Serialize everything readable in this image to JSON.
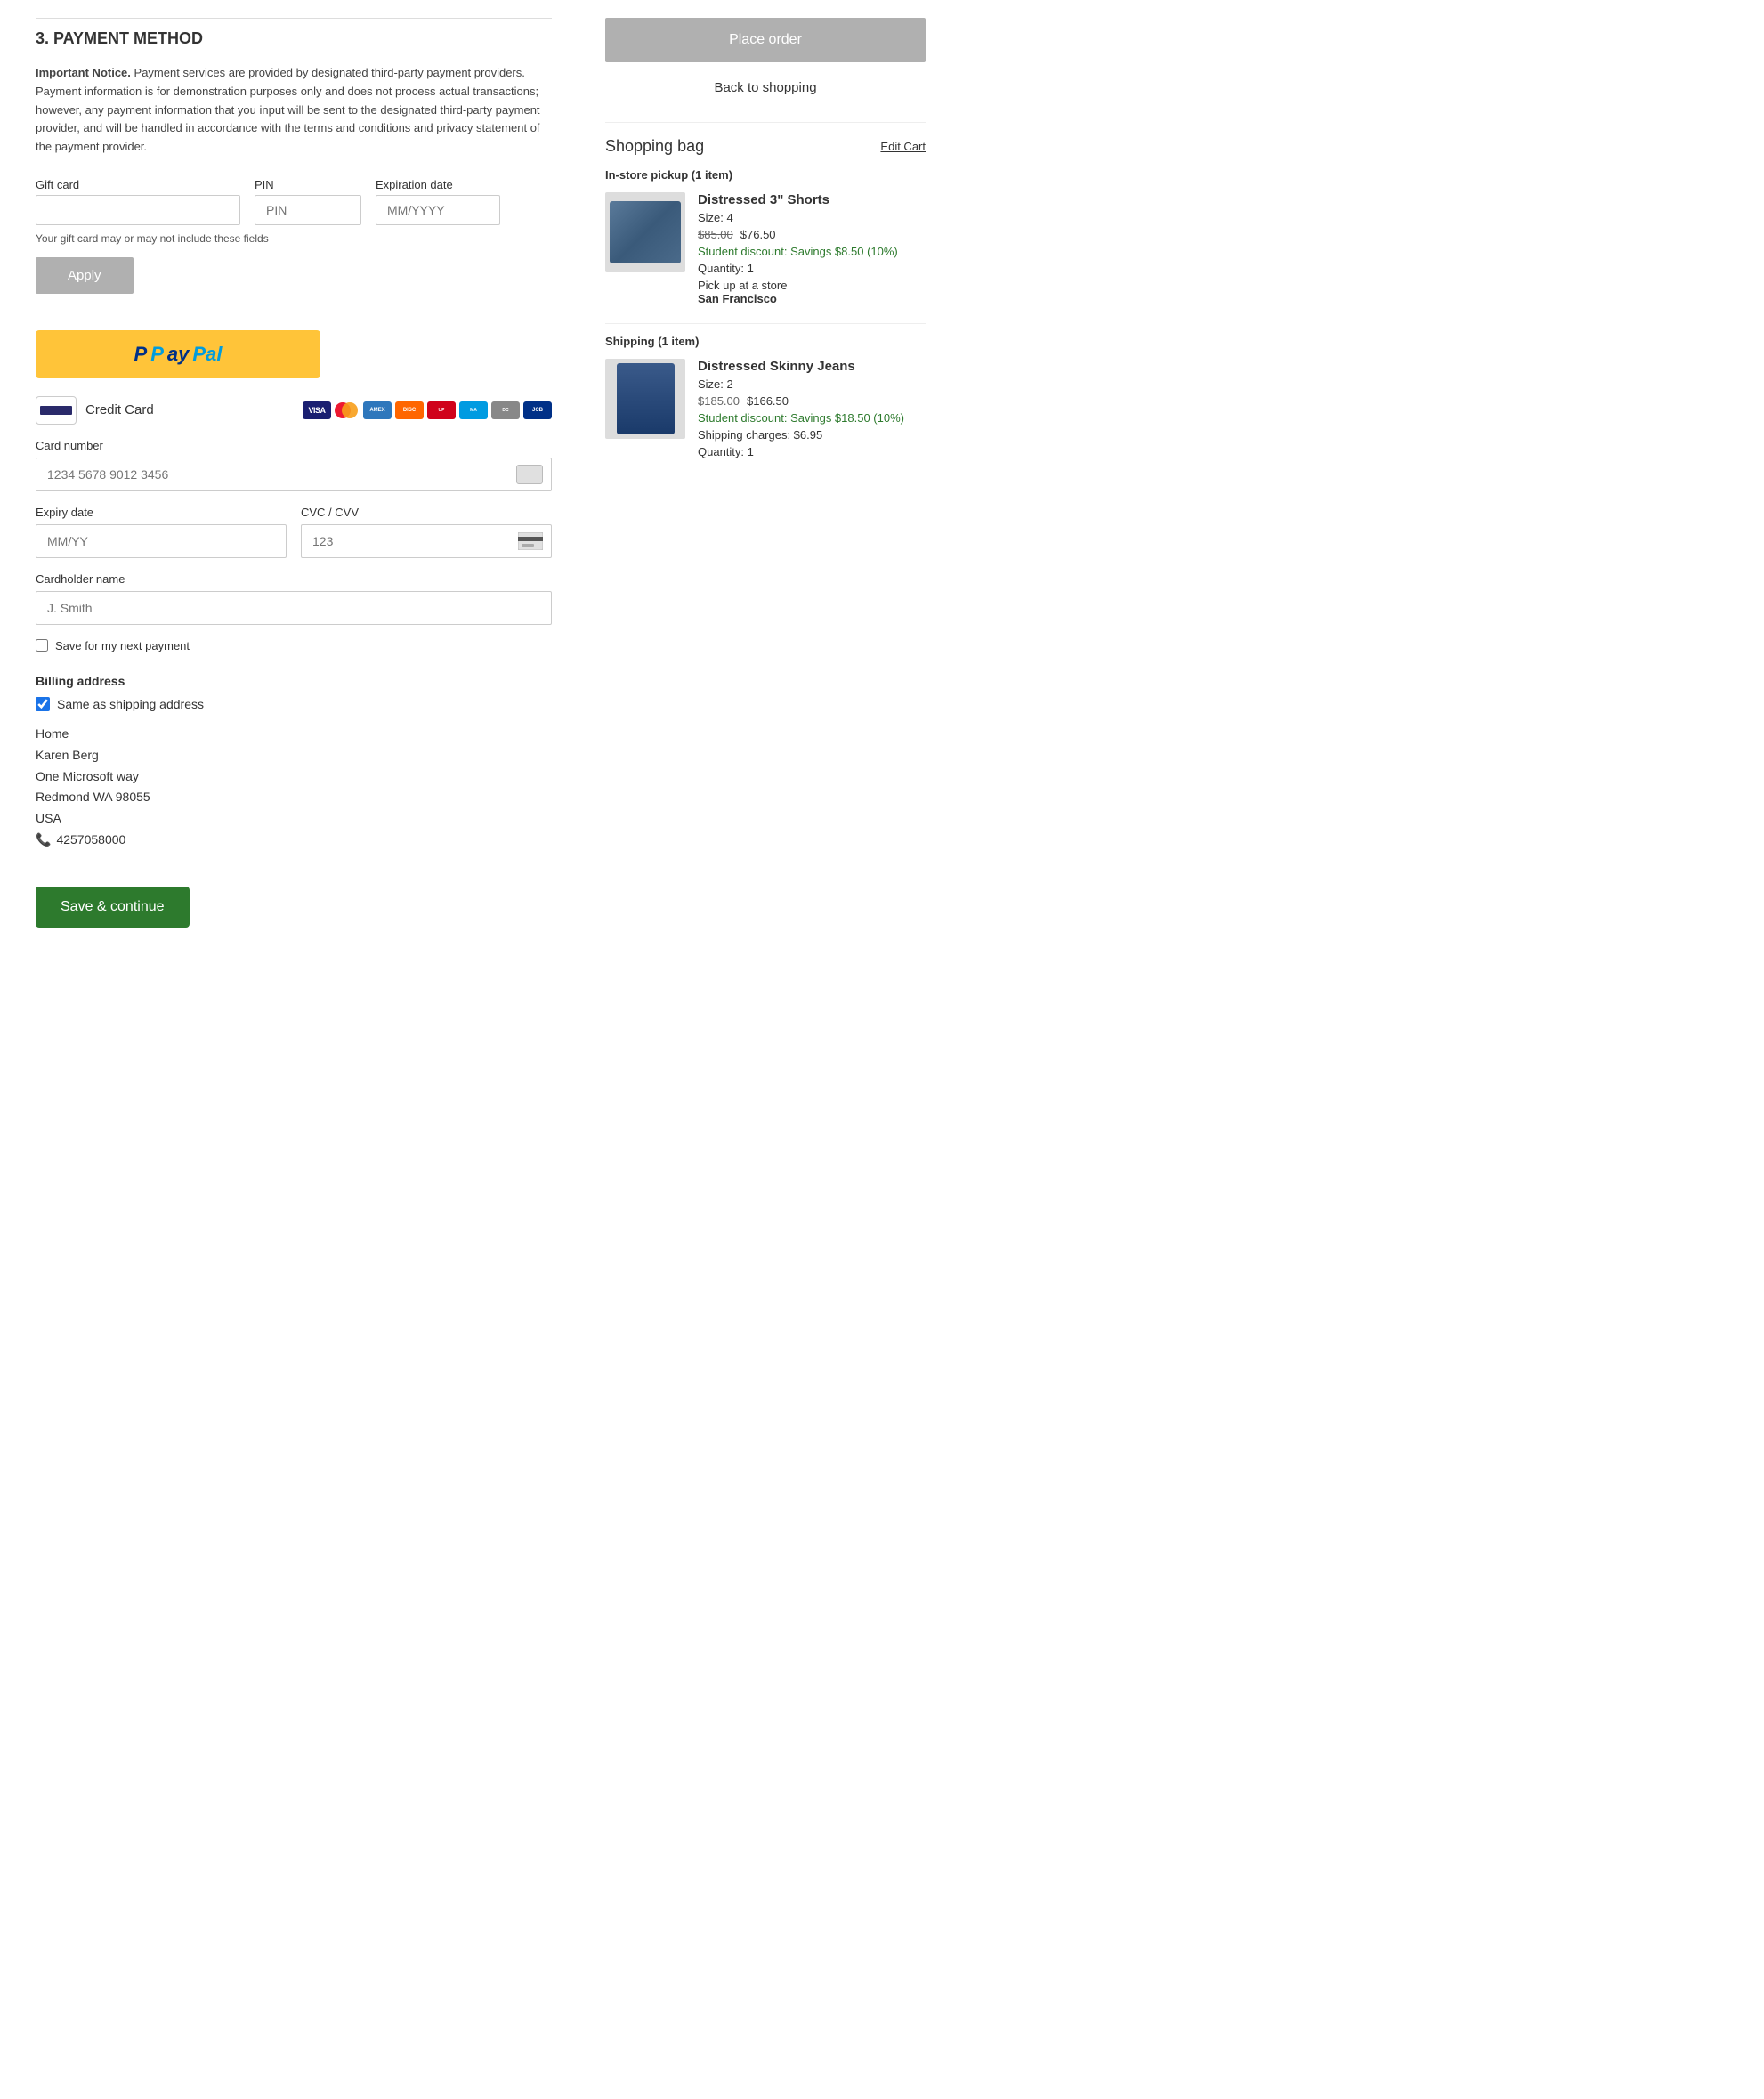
{
  "page": {
    "section_heading": "3. PAYMENT METHOD",
    "notice": {
      "label": "Important Notice.",
      "text": " Payment services are provided by designated third-party payment providers. Payment information is for demonstration purposes only and does not process actual transactions; however, any payment information that you input will be sent to the designated third-party payment provider, and will be handled in accordance with the terms and conditions and privacy statement of the payment provider."
    },
    "gift_card": {
      "label": "Gift card",
      "placeholder": "",
      "pin_label": "PIN",
      "pin_placeholder": "PIN",
      "expiration_label": "Expiration date",
      "expiration_placeholder": "MM/YYYY",
      "note": "Your gift card may or may not include these fields",
      "apply_button": "Apply"
    },
    "paypal": {
      "p1": "P",
      "p2": "P",
      "text": "ayPal"
    },
    "credit_card": {
      "label": "Credit Card",
      "card_number_label": "Card number",
      "card_number_placeholder": "1234 5678 9012 3456",
      "expiry_label": "Expiry date",
      "expiry_placeholder": "MM/YY",
      "cvc_label": "CVC / CVV",
      "cvc_placeholder": "123",
      "cardholder_label": "Cardholder name",
      "cardholder_placeholder": "J. Smith",
      "save_label": "Save for my next payment"
    },
    "billing": {
      "title": "Billing address",
      "same_as_shipping_label": "Same as shipping address",
      "address": {
        "type": "Home",
        "name": "Karen Berg",
        "street": "One Microsoft way",
        "city_state_zip": "Redmond WA  98055",
        "country": "USA",
        "phone": "4257058000"
      }
    },
    "save_continue_button": "Save & continue"
  },
  "right_panel": {
    "place_order_button": "Place order",
    "back_to_shopping": "Back to shopping",
    "shopping_bag": {
      "title": "Shopping bag",
      "edit_cart": "Edit Cart",
      "instore_pickup_label": "In-store pickup (1 item)",
      "item1": {
        "name": "Distressed 3\" Shorts",
        "size": "Size: 4",
        "original_price": "$85.00",
        "sale_price": "$76.50",
        "discount": "Student discount: Savings $8.50 (10%)",
        "quantity": "Quantity: 1",
        "pickup_label": "Pick up at a store",
        "pickup_store": "San Francisco"
      },
      "shipping_label": "Shipping (1 item)",
      "item2": {
        "name": "Distressed Skinny Jeans",
        "size": "Size: 2",
        "original_price": "$185.00",
        "sale_price": "$166.50",
        "discount": "Student discount: Savings $18.50 (10%)",
        "shipping_charges": "Shipping charges: $6.95",
        "quantity": "Quantity: 1"
      }
    }
  }
}
